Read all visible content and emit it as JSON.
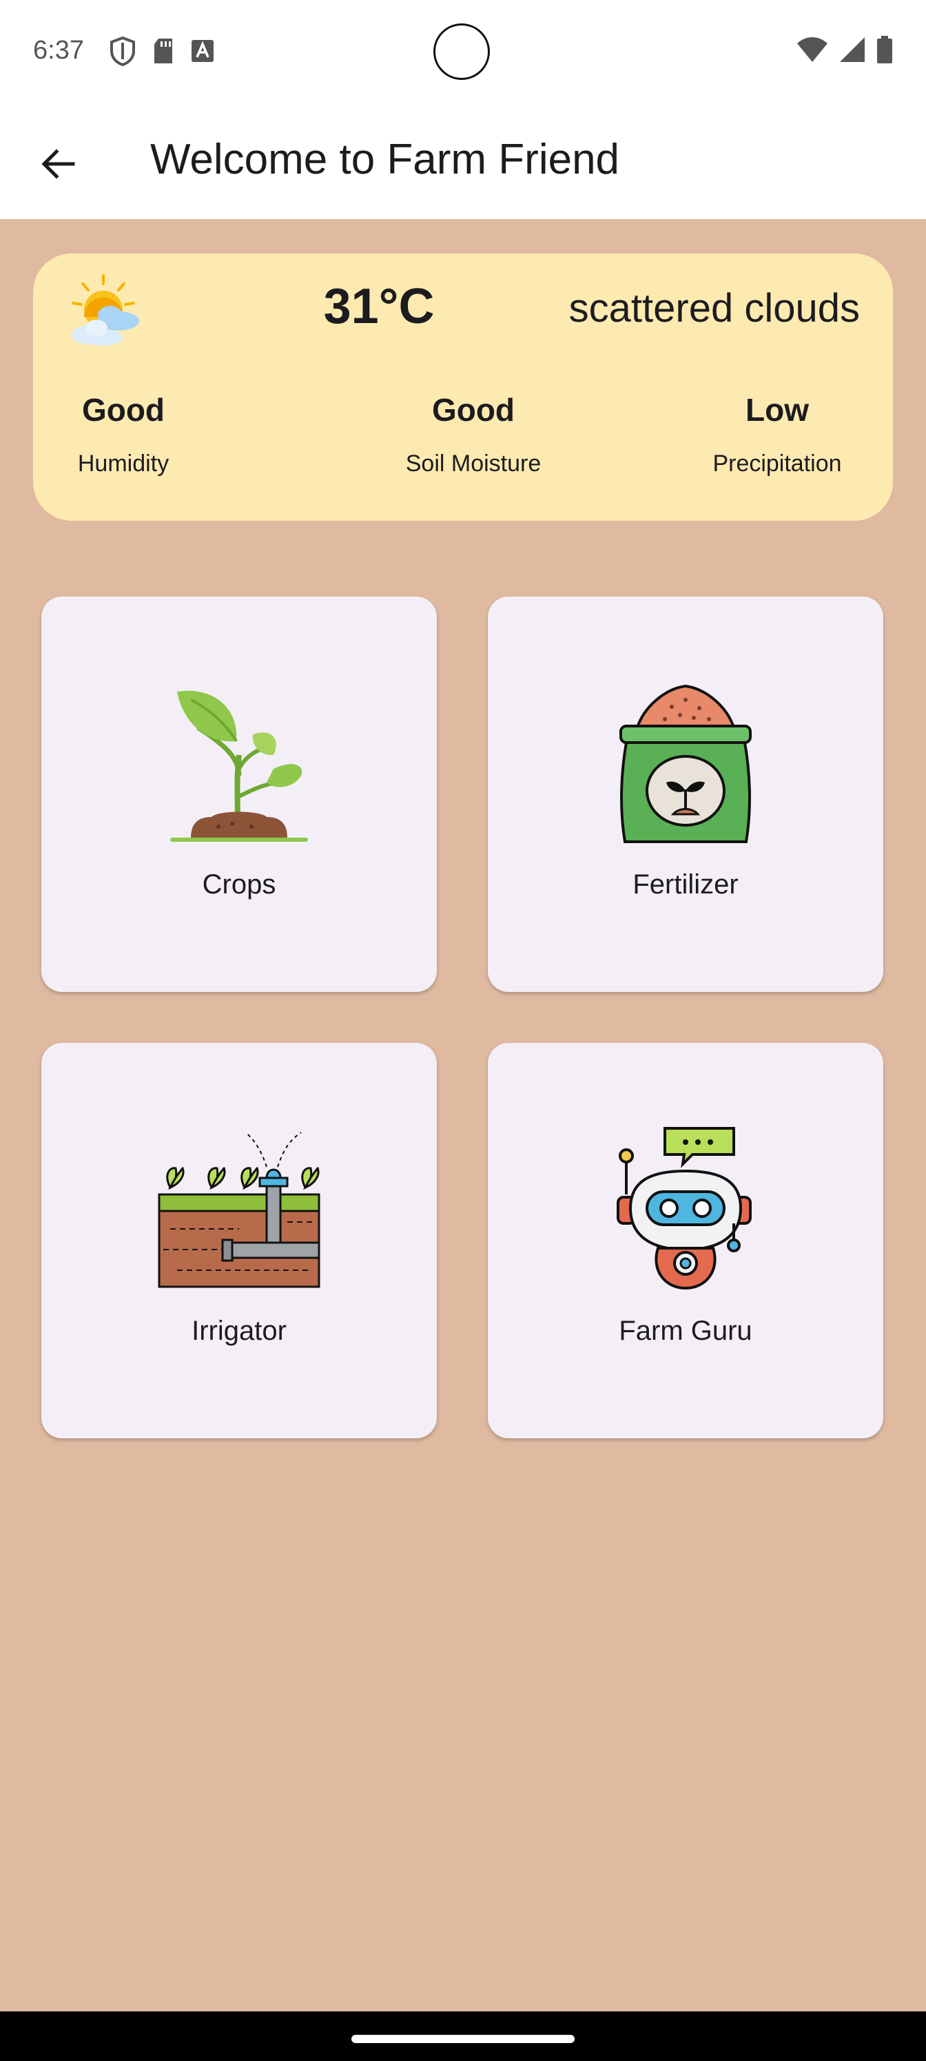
{
  "status_bar": {
    "time": "6:37",
    "icons_left": [
      "shield-icon",
      "sd-card-icon",
      "text-a-icon"
    ],
    "icons_right": [
      "wifi-icon",
      "signal-icon",
      "battery-icon"
    ]
  },
  "app_bar": {
    "back_icon": "arrow-back-icon",
    "title": "Welcome to Farm Friend"
  },
  "weather": {
    "icon": "sun-behind-clouds-icon",
    "temperature": "31°C",
    "description": "scattered clouds",
    "stats": [
      {
        "value": "Good",
        "label": "Humidity"
      },
      {
        "value": "Good",
        "label": "Soil Moisture"
      },
      {
        "value": "Low",
        "label": "Precipitation"
      }
    ]
  },
  "tiles": [
    {
      "label": "Crops",
      "icon": "sprout-icon"
    },
    {
      "label": "Fertilizer",
      "icon": "fertilizer-bag-icon"
    },
    {
      "label": "Irrigator",
      "icon": "sprinkler-icon"
    },
    {
      "label": "Farm Guru",
      "icon": "robot-chat-icon"
    }
  ],
  "colors": {
    "background": "#dfbaa0",
    "weather_card": "#fdeab0",
    "tile": "#f4eff7",
    "text": "#1c1b1f"
  }
}
